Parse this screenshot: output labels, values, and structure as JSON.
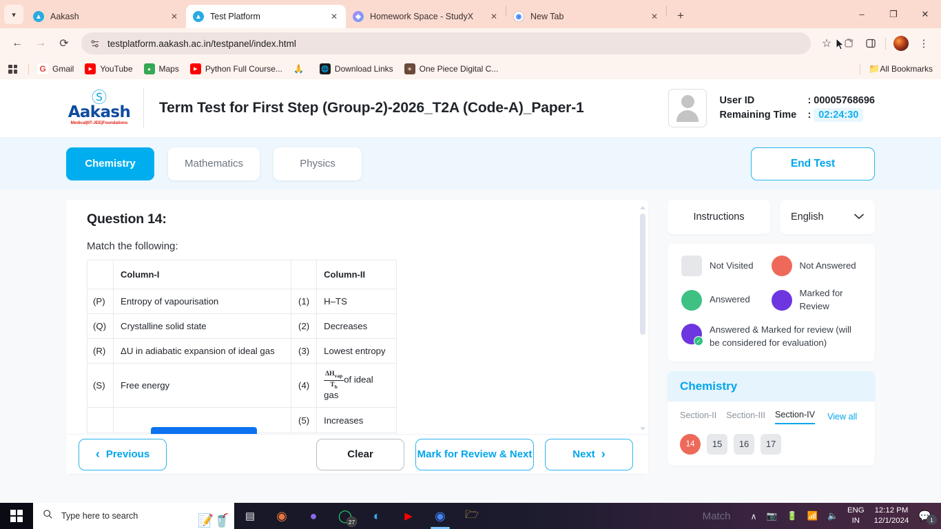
{
  "browser": {
    "tabs": [
      {
        "title": "Aakash",
        "favicon": "aakash-icon",
        "active": false
      },
      {
        "title": "Test Platform",
        "favicon": "aakash-icon",
        "active": true
      },
      {
        "title": "Homework Space - StudyX",
        "favicon": "studyx-icon",
        "active": false
      },
      {
        "title": "New Tab",
        "favicon": "chrome-icon",
        "active": false
      }
    ],
    "new_tab_label": "+",
    "window_controls": {
      "minimize": "–",
      "maximize": "❐",
      "close": "✕"
    },
    "nav": {
      "back": "←",
      "forward": "→",
      "reload": "⟳"
    },
    "url": "testplatform.aakash.ac.in/testpanel/index.html",
    "bookmark_star": "☆",
    "bookmarks": [
      {
        "label": "Gmail",
        "icon": "gmail-icon"
      },
      {
        "label": "YouTube",
        "icon": "youtube-icon"
      },
      {
        "label": "Maps",
        "icon": "maps-icon"
      },
      {
        "label": "Python Full Course...",
        "icon": "youtube-icon"
      },
      {
        "label": "",
        "icon": "namaste-icon"
      },
      {
        "label": "Download Links",
        "icon": "globe-icon"
      },
      {
        "label": "One Piece Digital C...",
        "icon": "onepiece-icon"
      }
    ],
    "all_bookmarks_label": "All Bookmarks"
  },
  "header": {
    "logo": {
      "name": "Aakash",
      "tagline": "Medical|IIT-JEE|Foundations"
    },
    "test_title": "Term Test for First Step (Group-2)-2026_T2A (Code-A)_Paper-1",
    "user_id_label": "User ID",
    "user_id_value": "00005768696",
    "remaining_time_label": "Remaining Time",
    "remaining_time_value": "02:24:30",
    "colon": ":"
  },
  "subjects": {
    "tabs": [
      {
        "label": "Chemistry",
        "active": true
      },
      {
        "label": "Mathematics",
        "active": false
      },
      {
        "label": "Physics",
        "active": false
      }
    ],
    "end_test_label": "End Test"
  },
  "question": {
    "title": "Question 14:",
    "prompt": "Match the following:",
    "table": {
      "headers": [
        "",
        "Column-I",
        "",
        "Column-II"
      ],
      "rows": [
        {
          "k1": "(P)",
          "t1": "Entropy of vapourisation",
          "k2": "(1)",
          "t2": "H–TS"
        },
        {
          "k1": "(Q)",
          "t1": "Crystalline solid state",
          "k2": "(2)",
          "t2": "Decreases"
        },
        {
          "k1": "(R)",
          "t1": "ΔU in adiabatic expansion of ideal gas",
          "k2": "(3)",
          "t2": "Lowest entropy"
        },
        {
          "k1": "(S)",
          "t1": "Free energy",
          "k2": "(4)",
          "t2": "of ideal gas",
          "frac_num": "ΔH",
          "frac_num_sub": "vap",
          "frac_den": "T",
          "frac_den_sub": "b"
        },
        {
          "k1": "",
          "t1": "",
          "k2": "(5)",
          "t2": "Increases"
        }
      ]
    }
  },
  "actions": {
    "previous": "Previous",
    "previous_arrow": "‹",
    "clear": "Clear",
    "mark_review_next": "Mark for Review & Next",
    "next": "Next",
    "next_arrow": "›"
  },
  "sidebar": {
    "instructions_label": "Instructions",
    "language_value": "English",
    "language_chevron": "chevron-down-icon",
    "legend": [
      {
        "label": "Not Visited",
        "color": "#e5e7ea",
        "shape": "square"
      },
      {
        "label": "Not Answered",
        "color": "#ed6a5a",
        "shape": "circle"
      },
      {
        "label": "Answered",
        "color": "#3ec183",
        "shape": "circle"
      },
      {
        "label": "Marked for Review",
        "color": "#6d36e0",
        "shape": "circle"
      },
      {
        "label": "Answered & Marked for review (will be considered for evaluation)",
        "color": "#6d36e0",
        "shape": "circle-badge"
      }
    ],
    "palette": {
      "subject": "Chemistry",
      "sections": [
        {
          "label": "Section-II",
          "active": false
        },
        {
          "label": "Section-III",
          "active": false
        },
        {
          "label": "Section-IV",
          "active": true
        }
      ],
      "view_all": "View all",
      "questions": [
        {
          "num": "14",
          "state": "not-answered"
        },
        {
          "num": "15",
          "state": "not-visited"
        },
        {
          "num": "16",
          "state": "not-visited"
        },
        {
          "num": "17",
          "state": "not-visited"
        }
      ]
    }
  },
  "taskbar": {
    "search_placeholder": "Type here to search",
    "items": [
      {
        "name": "task-view-icon",
        "glyph": "⌷"
      },
      {
        "name": "copilot-icon",
        "glyph": "◐"
      },
      {
        "name": "edge-copilot-icon",
        "glyph": "●"
      },
      {
        "name": "whatsapp-icon",
        "glyph": "◯",
        "count": "27"
      },
      {
        "name": "edge-icon",
        "glyph": "◔"
      },
      {
        "name": "youtube-icon",
        "glyph": "▶"
      },
      {
        "name": "chrome-icon",
        "glyph": "◉",
        "active": true
      },
      {
        "name": "file-explorer-icon",
        "glyph": "▤"
      }
    ],
    "watermark": "Match",
    "show_hidden": "∧",
    "language_line1": "ENG",
    "language_line2": "IN",
    "time": "12:12 PM",
    "date": "12/1/2024",
    "notification_count": "1"
  }
}
